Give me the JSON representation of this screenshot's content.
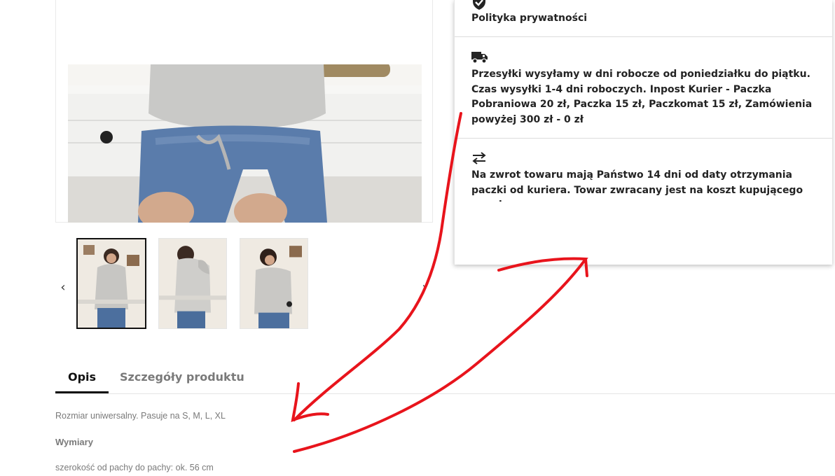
{
  "gallery": {
    "prev_arrow": "‹",
    "next_arrow": "›",
    "thumbnails": [
      {
        "name": "thumbnail-1",
        "active": true
      },
      {
        "name": "thumbnail-2",
        "active": false
      },
      {
        "name": "thumbnail-3",
        "active": false
      }
    ]
  },
  "info_panel": {
    "privacy": {
      "icon": "shield-check-icon",
      "title": "Polityka prywatności"
    },
    "shipping": {
      "icon": "truck-icon",
      "text": "Przesyłki wysyłamy w dni robocze od poniedziałku do piątku. Czas wysyłki 1-4 dni roboczych. Inpost Kurier - Paczka Pobraniowa 20 zł, Paczka 15 zł, Paczkomat 15 zł, Zamówienia powyżej 300 zł - 0 zł"
    },
    "returns": {
      "icon": "swap-arrows-icon",
      "text": "Na zwrot towaru mają Państwo 14 dni od daty otrzymania paczki od kuriera. Towar zwracany jest na koszt kupującego na adres:"
    }
  },
  "tabs": [
    {
      "label": "Opis",
      "active": true
    },
    {
      "label": "Szczegóły produktu",
      "active": false
    }
  ],
  "description": {
    "size_line": "Rozmiar uniwersalny. Pasuje na S, M, L, XL",
    "dimensions_heading": "Wymiary",
    "width_line": "szerokość od pachy do pachy: ok. 56 cm"
  },
  "colors": {
    "annotation": "#e8141c",
    "accent": "#111111"
  }
}
